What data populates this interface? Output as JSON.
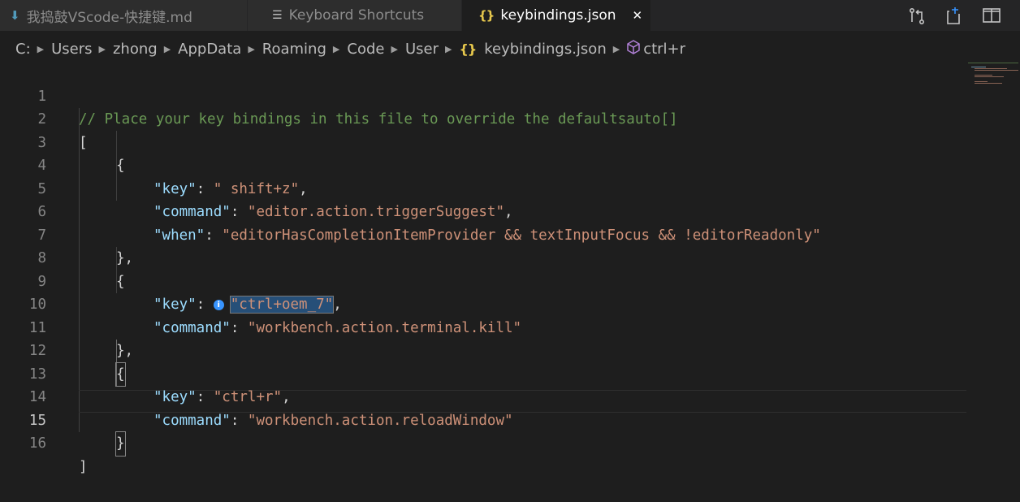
{
  "tabs": [
    {
      "label": "我捣鼓VScode-快捷键.md",
      "icon": "markdown-download-icon",
      "active": false
    },
    {
      "label": "Keyboard Shortcuts",
      "icon": "list-icon",
      "active": false
    },
    {
      "label": "keybindings.json",
      "icon": "json-braces-icon",
      "active": true,
      "close": "✕"
    }
  ],
  "tab_actions": [
    "open-changes-icon",
    "open-preview-icon",
    "split-editor-icon"
  ],
  "breadcrumbs": [
    "C:",
    "Users",
    "zhong",
    "AppData",
    "Roaming",
    "Code",
    "User",
    "keybindings.json",
    "ctrl+r"
  ],
  "editor": {
    "lines": [
      {
        "n": "1",
        "comment": "// Place your key bindings in this file to override the defaultsauto[]"
      },
      {
        "n": "2",
        "text": "["
      },
      {
        "n": "3",
        "text": "{"
      },
      {
        "n": "4",
        "key": "\"key\"",
        "sep": ": ",
        "value": "\" shift+z\"",
        "end": ","
      },
      {
        "n": "5",
        "key": "\"command\"",
        "sep": ": ",
        "value": "\"editor.action.triggerSuggest\"",
        "end": ","
      },
      {
        "n": "6",
        "key": "\"when\"",
        "sep": ": ",
        "value": "\"editorHasCompletionItemProvider && textInputFocus && !editorReadonly\"",
        "end": ""
      },
      {
        "n": "7",
        "text": "},"
      },
      {
        "n": "8",
        "text": "{"
      },
      {
        "n": "9",
        "key": "\"key\"",
        "sep": ": ",
        "value": "\"ctrl+oem_7\"",
        "end": ",",
        "info": "i"
      },
      {
        "n": "10",
        "key": "\"command\"",
        "sep": ": ",
        "value": "\"workbench.action.terminal.kill\"",
        "end": ""
      },
      {
        "n": "11",
        "text": "},"
      },
      {
        "n": "12",
        "text": "{"
      },
      {
        "n": "13",
        "key": "\"key\"",
        "sep": ": ",
        "value": "\"ctrl+r\"",
        "end": ","
      },
      {
        "n": "14",
        "key": "\"command\"",
        "sep": ": ",
        "value": "\"workbench.action.reloadWindow\"",
        "end": ""
      },
      {
        "n": "15",
        "text": "}"
      },
      {
        "n": "16",
        "text": "]"
      }
    ],
    "active_line": "15"
  },
  "colors": {
    "background": "#1e1e1e",
    "comment": "#6a9955",
    "json_key": "#9cdcfe",
    "json_string": "#ce9178",
    "json_icon": "#e8c94d",
    "info_icon": "#3794ff"
  }
}
